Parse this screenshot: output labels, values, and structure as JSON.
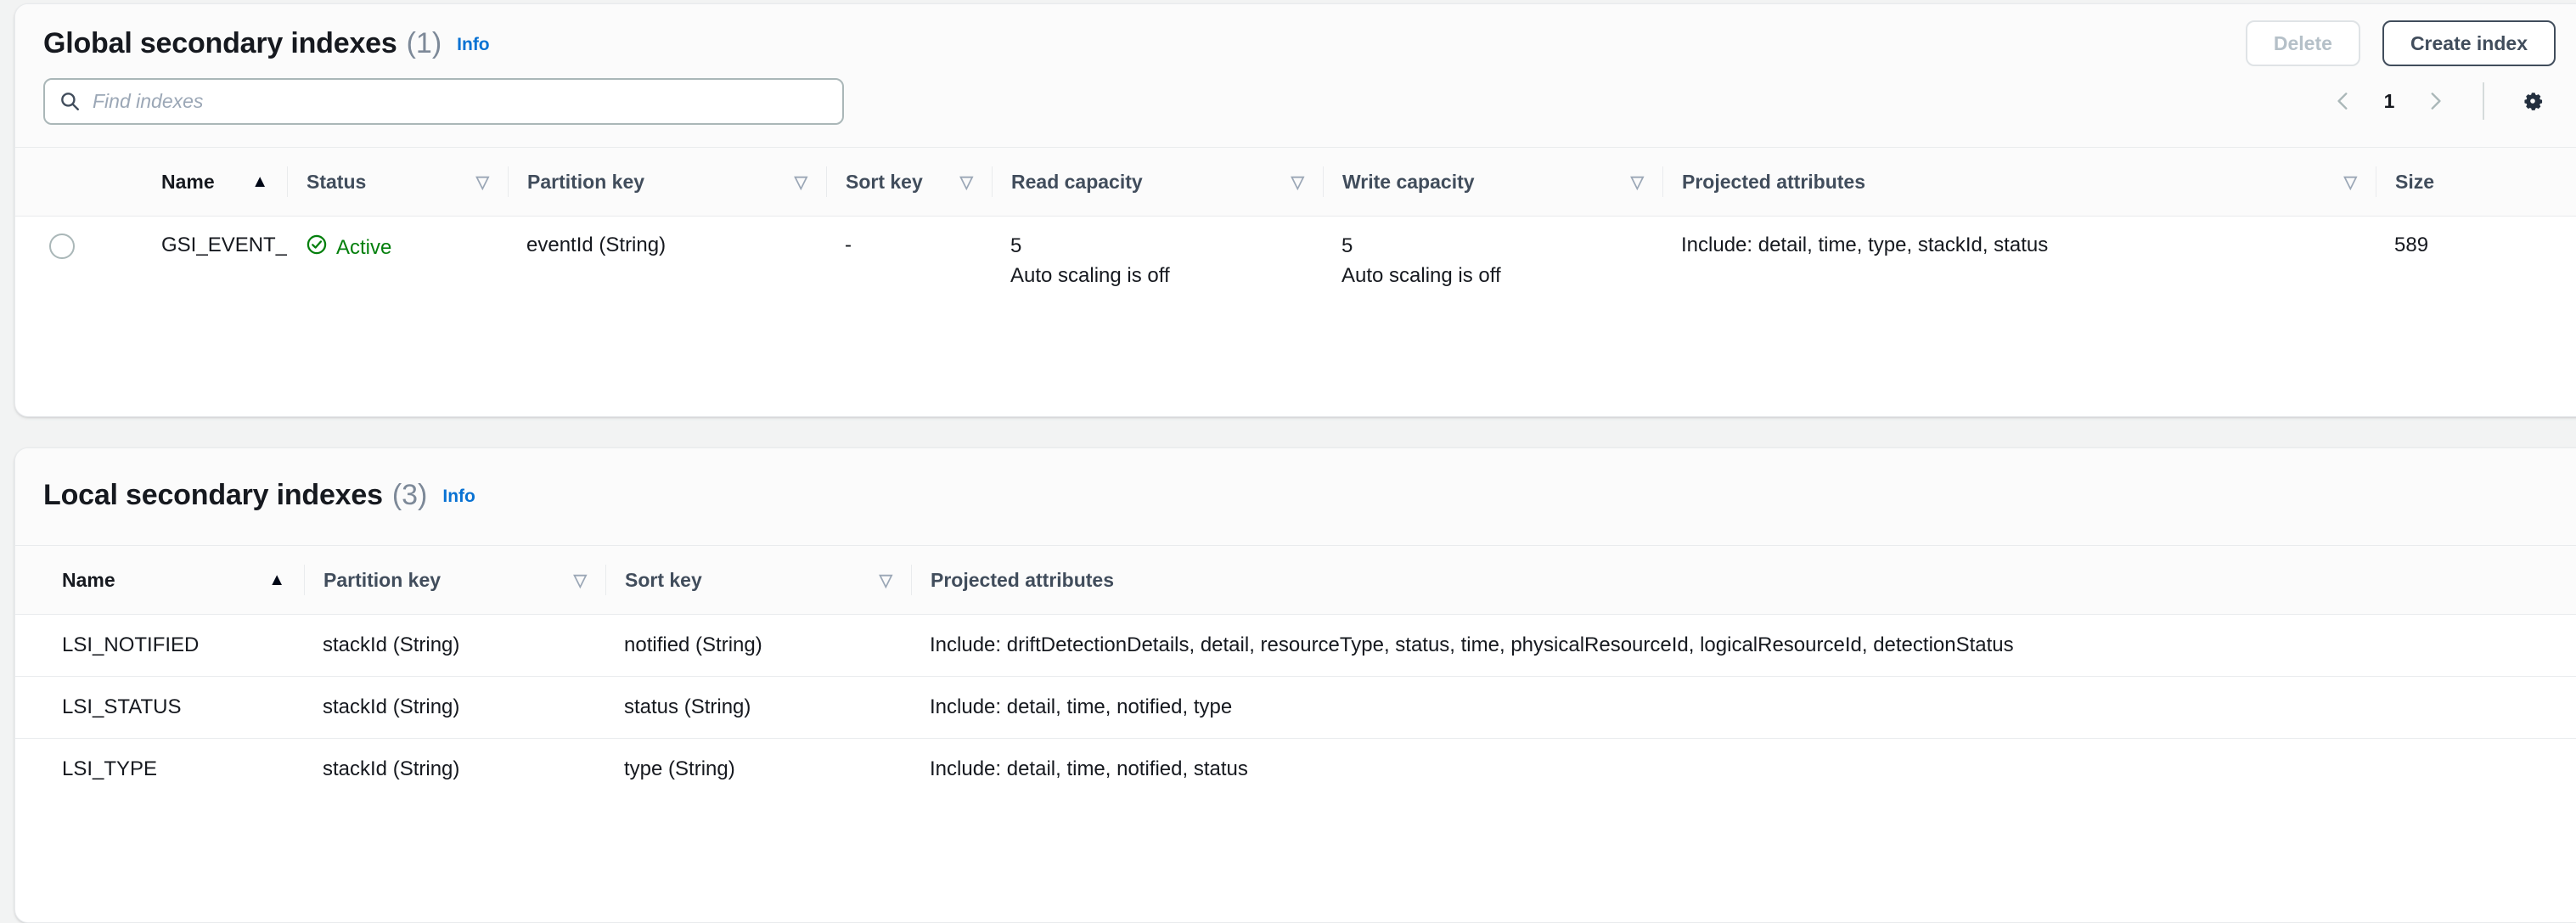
{
  "gsi": {
    "title": "Global secondary indexes",
    "count": "(1)",
    "info_label": "Info",
    "delete_label": "Delete",
    "create_label": "Create index",
    "search": {
      "placeholder": "Find indexes",
      "value": "",
      "icon": "search-icon"
    },
    "pagination": {
      "prev_icon": "chevron-left-icon",
      "page": "1",
      "next_icon": "chevron-right-icon",
      "settings_icon": "gear-icon"
    },
    "columns": [
      {
        "label": "Name",
        "sort": "asc"
      },
      {
        "label": "Status",
        "sort": "idle"
      },
      {
        "label": "Partition key",
        "sort": "idle"
      },
      {
        "label": "Sort key",
        "sort": "idle"
      },
      {
        "label": "Read capacity",
        "sort": "idle"
      },
      {
        "label": "Write capacity",
        "sort": "idle"
      },
      {
        "label": "Projected attributes",
        "sort": "idle"
      },
      {
        "label": "Size",
        "sort": "none"
      }
    ],
    "rows": [
      {
        "name": "GSI_EVENT_ID",
        "status": "Active",
        "status_icon": "check-circle-icon",
        "partition_key": "eventId (String)",
        "sort_key": "-",
        "read_capacity": "5",
        "read_capacity_sub": "Auto scaling is off",
        "write_capacity": "5",
        "write_capacity_sub": "Auto scaling is off",
        "projected_attributes": "Include: detail, time, type, stackId, status",
        "size": "589"
      }
    ]
  },
  "lsi": {
    "title": "Local secondary indexes",
    "count": "(3)",
    "info_label": "Info",
    "columns": [
      {
        "label": "Name",
        "sort": "asc"
      },
      {
        "label": "Partition key",
        "sort": "idle"
      },
      {
        "label": "Sort key",
        "sort": "idle"
      },
      {
        "label": "Projected attributes",
        "sort": "none"
      }
    ],
    "rows": [
      {
        "name": "LSI_NOTIFIED",
        "partition_key": "stackId (String)",
        "sort_key": "notified (String)",
        "projected_attributes": "Include: driftDetectionDetails, detail, resourceType, status, time, physicalResourceId, logicalResourceId, detectionStatus"
      },
      {
        "name": "LSI_STATUS",
        "partition_key": "stackId (String)",
        "sort_key": "status (String)",
        "projected_attributes": "Include: detail, time, notified, type"
      },
      {
        "name": "LSI_TYPE",
        "partition_key": "stackId (String)",
        "sort_key": "type (String)",
        "projected_attributes": "Include: detail, time, notified, status"
      }
    ]
  },
  "colors": {
    "link": "#0972d3",
    "status_active": "#037f0c",
    "text_primary": "#16191f",
    "text_secondary": "#414d5c",
    "border": "#e9ebed",
    "page_background": "#f2f3f3",
    "panel_header": "#fbfbfb"
  }
}
